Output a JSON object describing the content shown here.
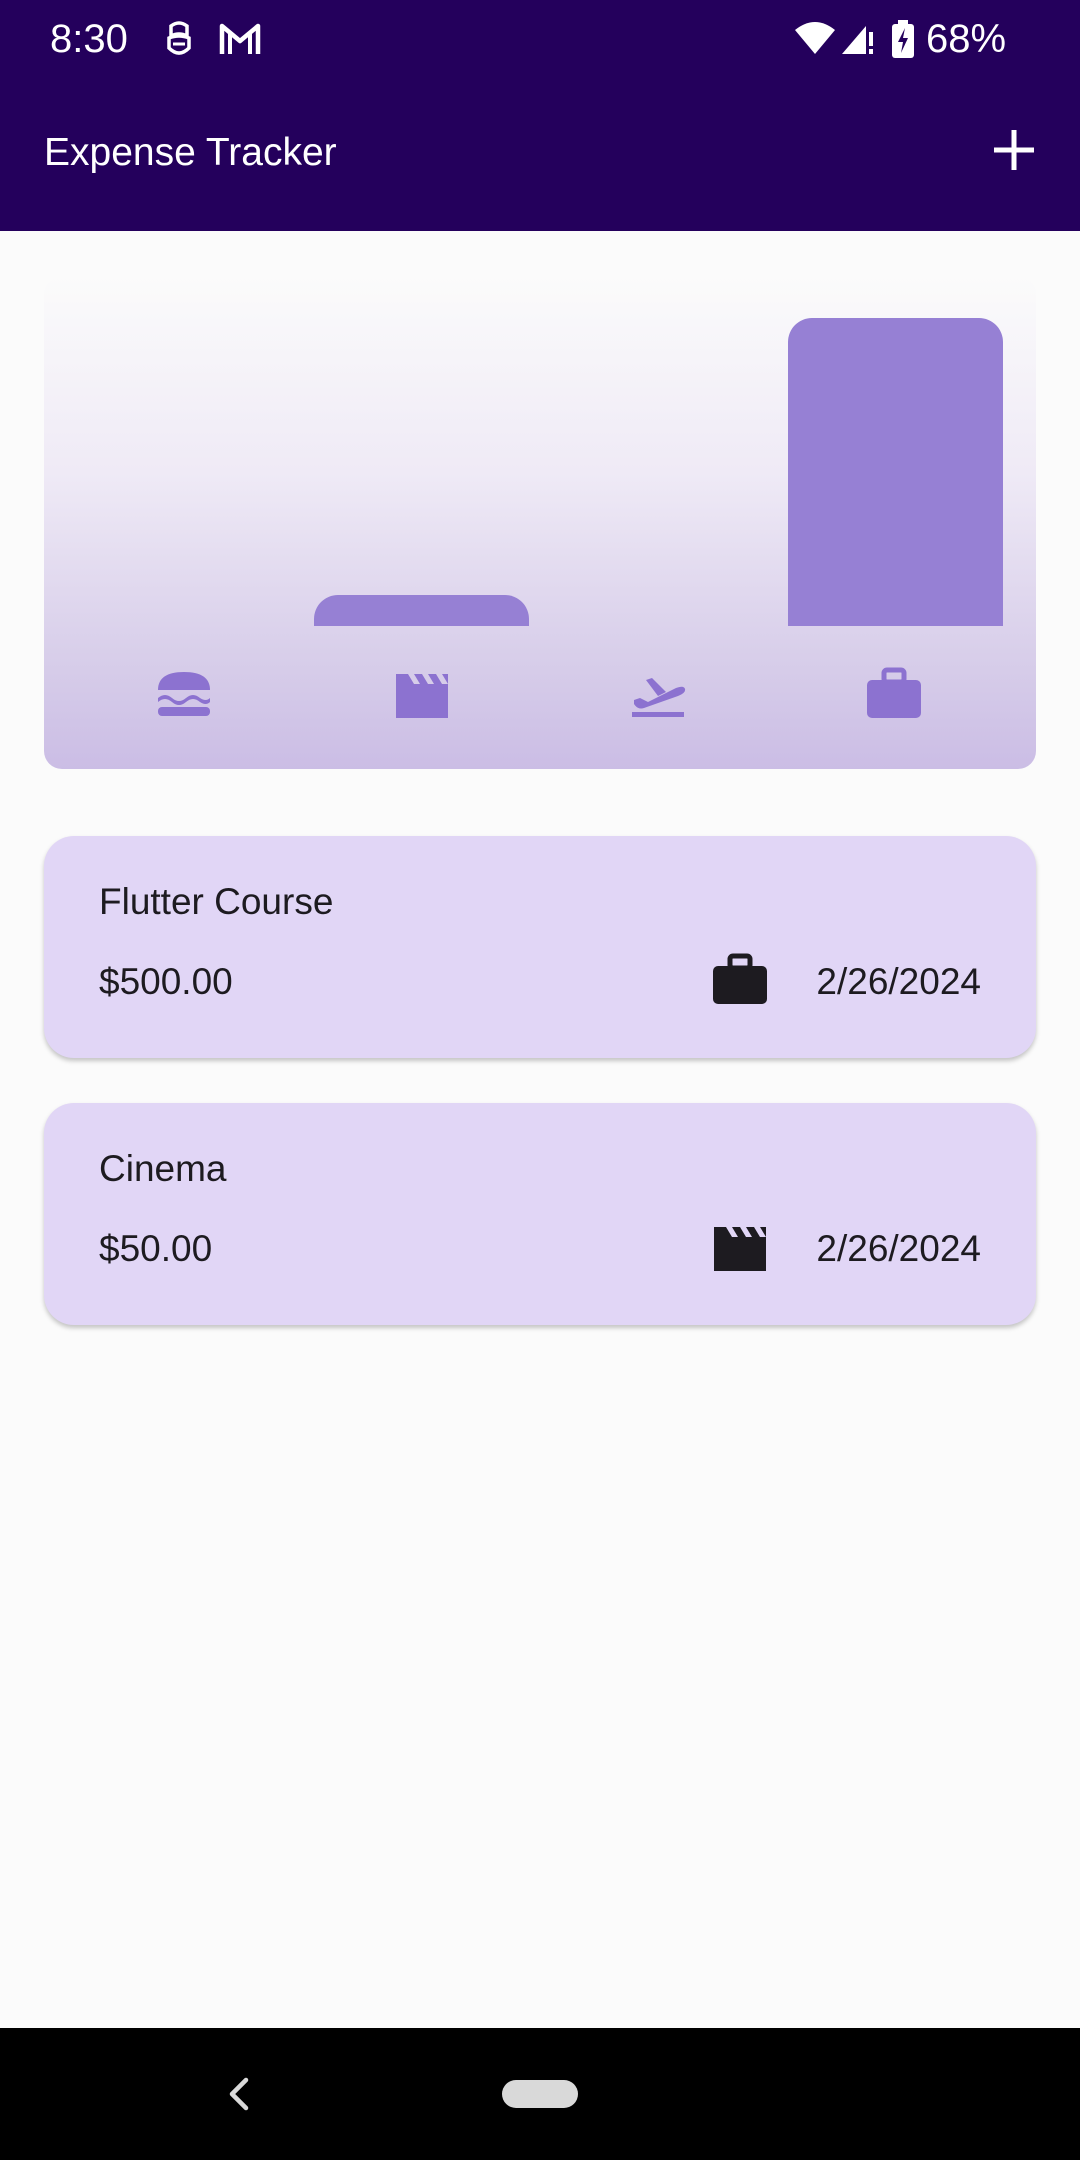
{
  "status_bar": {
    "time": "8:30",
    "battery": "68%",
    "icons": [
      "app-notification-icon",
      "gmail-icon",
      "wifi-icon",
      "signal-icon",
      "battery-charging-icon"
    ]
  },
  "app_bar": {
    "title": "Expense Tracker",
    "action_icon": "add-icon"
  },
  "chart_data": {
    "type": "bar",
    "categories": [
      "food",
      "leisure",
      "travel",
      "work"
    ],
    "category_icons": [
      "burger-icon",
      "clapperboard-icon",
      "flight-takeoff-icon",
      "briefcase-icon"
    ],
    "values": [
      0,
      50,
      0,
      500
    ],
    "ylim": [
      0,
      500
    ],
    "bar_color": "#9680d4",
    "icon_color": "#8c72d0"
  },
  "expenses": [
    {
      "title": "Flutter Course",
      "amount": "$500.00",
      "category_icon": "briefcase-icon",
      "date": "2/26/2024"
    },
    {
      "title": "Cinema",
      "amount": "$50.00",
      "category_icon": "clapperboard-icon",
      "date": "2/26/2024"
    }
  ],
  "colors": {
    "app_bar": "#24005c",
    "card": "#e1d6f6",
    "text": "#1d1b20"
  },
  "nav_bar": {
    "icons": [
      "back-icon",
      "home-pill-icon"
    ]
  }
}
